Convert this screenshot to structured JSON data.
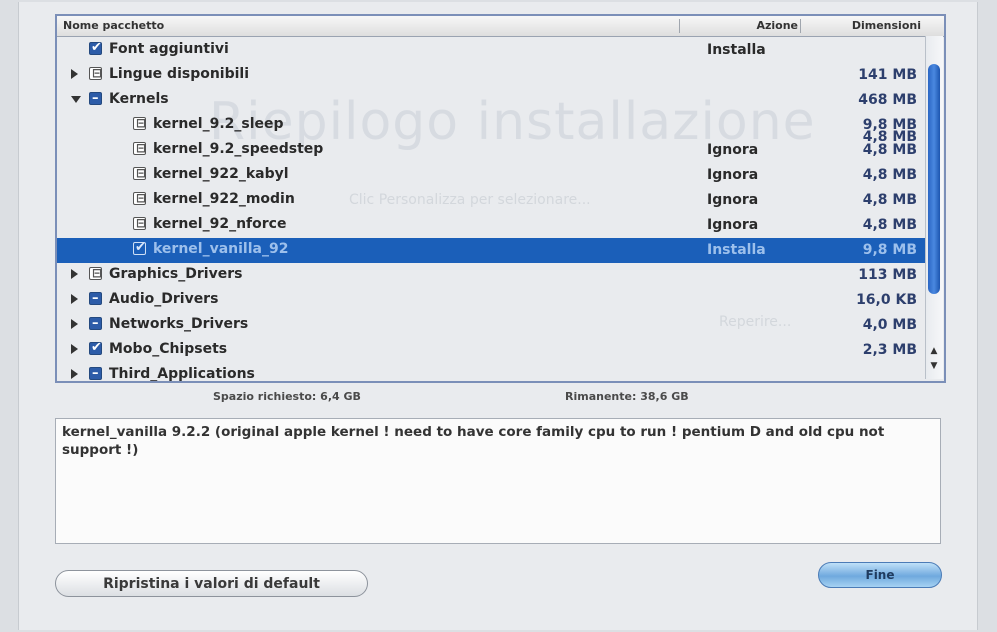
{
  "background_text": {
    "title": "Riepilogo installazione",
    "subtitle": "Clic Personalizza per selezionare...",
    "right_text": "Reperire..."
  },
  "table": {
    "headers": {
      "name": "Nome pacchetto",
      "action": "Azione",
      "size": "Dimensioni"
    },
    "rows": [
      {
        "indent": 0,
        "disclosure": "none",
        "check": "checked",
        "label": "Font aggiuntivi",
        "action": "Installa",
        "size": "",
        "selected": false
      },
      {
        "indent": 0,
        "disclosure": "closed",
        "check": "unchecked",
        "label": "Lingue disponibili",
        "action": "",
        "size": "141 MB",
        "selected": false
      },
      {
        "indent": 0,
        "disclosure": "open",
        "check": "mixed",
        "label": "Kernels",
        "action": "",
        "size": "468 MB",
        "selected": false
      },
      {
        "indent": 1,
        "disclosure": "none",
        "check": "unchecked",
        "label": "kernel_9.2_sleep",
        "action": "",
        "size": "9,8 MB",
        "selected": false
      },
      {
        "indent": 1,
        "disclosure": "none",
        "check": "unchecked",
        "label": "kernel_9.2_speedstep",
        "action": "Ignora",
        "size": "4,8 MB",
        "selected": false
      },
      {
        "indent": 1,
        "disclosure": "none",
        "check": "unchecked",
        "label": "kernel_922_kabyl",
        "action": "Ignora",
        "size": "4,8 MB",
        "selected": false
      },
      {
        "indent": 1,
        "disclosure": "none",
        "check": "unchecked",
        "label": "kernel_922_modin",
        "action": "Ignora",
        "size": "4,8 MB",
        "selected": false
      },
      {
        "indent": 1,
        "disclosure": "none",
        "check": "unchecked",
        "label": "kernel_92_nforce",
        "action": "Ignora",
        "size": "4,8 MB",
        "selected": false
      },
      {
        "indent": 1,
        "disclosure": "none",
        "check": "checked",
        "label": "kernel_vanilla_92",
        "action": "Installa",
        "size": "9,8 MB",
        "selected": true
      },
      {
        "indent": 0,
        "disclosure": "closed",
        "check": "unchecked",
        "label": "Graphics_Drivers",
        "action": "",
        "size": "113 MB",
        "selected": false
      },
      {
        "indent": 0,
        "disclosure": "closed",
        "check": "mixed",
        "label": "Audio_Drivers",
        "action": "",
        "size": "16,0 KB",
        "selected": false
      },
      {
        "indent": 0,
        "disclosure": "closed",
        "check": "mixed",
        "label": "Networks_Drivers",
        "action": "",
        "size": "4,0 MB",
        "selected": false
      },
      {
        "indent": 0,
        "disclosure": "closed",
        "check": "checked",
        "label": "Mobo_Chipsets",
        "action": "",
        "size": "2,3 MB",
        "selected": false
      },
      {
        "indent": 0,
        "disclosure": "closed",
        "check": "mixed",
        "label": "Third_Applications",
        "action": "",
        "size": "",
        "selected": false
      }
    ],
    "extra_size": "4,8 MB"
  },
  "summary": {
    "required_label": "Spazio richiesto:",
    "required_value": "6,4 GB",
    "remaining_label": "Rimanente:",
    "remaining_value": "38,6 GB"
  },
  "description": "kernel_vanilla 9.2.2 (original apple kernel ! need to have core family cpu to run ! pentium D and old cpu not support !)",
  "buttons": {
    "reset": "Ripristina i valori di default",
    "done": "Fine"
  },
  "colors": {
    "selection": "#1b5fb9",
    "scroll_thumb": "#2a66c4",
    "accent_button": "#6fa9de"
  }
}
